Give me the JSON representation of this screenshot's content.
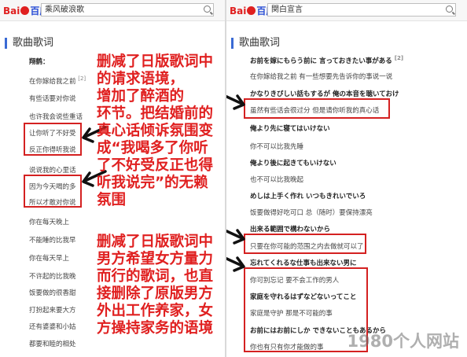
{
  "left_panel": {
    "logo": {
      "bai": "Bai",
      "du": "百度"
    },
    "search_value": "乘风破浪歌",
    "section_title": "歌曲歌词",
    "lyrics": [
      "翔鹤：",
      "在你嫁给我之前",
      "有些话要对你说",
      "也许我会说些重话",
      "让你听了不好受",
      "反正你得听我说",
      "说说我的心里话",
      "因为今天喝的多",
      "所以才敢对你说",
      "你在每天晚上",
      "不能睡的比我早",
      "你在每天早上",
      "不许起的比我晚",
      "饭要做的很香甜",
      "打扮起来要大方",
      "还有婆婆和小姑",
      "都要和睦的相处"
    ],
    "lyric_footnote": "[2]"
  },
  "right_panel": {
    "logo": {
      "bai": "Bai",
      "du": "百度"
    },
    "search_value": "関白宣言",
    "section_title": "歌曲歌词",
    "lyrics": [
      "お前を嫁にもらう前に 言っておきたい事がある",
      "在你嫁给我之前 有一些想要先告诉你的事说一说",
      "かなりきびしい話もするが 俺の本音を聴いておけ",
      "虽然有些话会很过分 但是请你听我的真心话",
      "俺より先に寝てはいけない",
      "你不可以比我先睡",
      "俺より後に起きてもいけない",
      "也不可以比我晚起",
      "めしは上手く作れ いつもきれいでいろ",
      "饭要做得好吃可口 总（随时）要保持漂亮",
      "出来る範囲で構わないから",
      "只要在你可能的范围之内去做就可以了",
      "忘れてくれるな仕事も出来ない男に",
      "你可别忘记 要不会工作的男人",
      "家庭を守れるはずなどないってこと",
      "家庭是守护 那是不可能的事",
      "お前にはお前にしか できないこともあるから",
      "你也有只有你才能做的事"
    ],
    "lyric_footnote": "[2]"
  },
  "annotations": {
    "note1": [
      "删减了日版歌词中",
      "的请求语境，",
      "增加了醉酒的",
      "环节。把结婚前的",
      "真心话倾诉氛围变",
      "成“我喝多了你听",
      "了不好受反正也得",
      "听我说完”的无赖",
      "氛围"
    ],
    "note2": [
      "删减了日版歌词中",
      "男方希望女方量力",
      "而行的歌词，也直",
      "接删除了原版男方",
      "外出工作养家，女",
      "方操持家务的语境"
    ]
  },
  "watermark": "1980个人网站",
  "colors": {
    "annotation": "#e02020",
    "box": "#d42121",
    "brand_blue": "#2b4fd6"
  }
}
